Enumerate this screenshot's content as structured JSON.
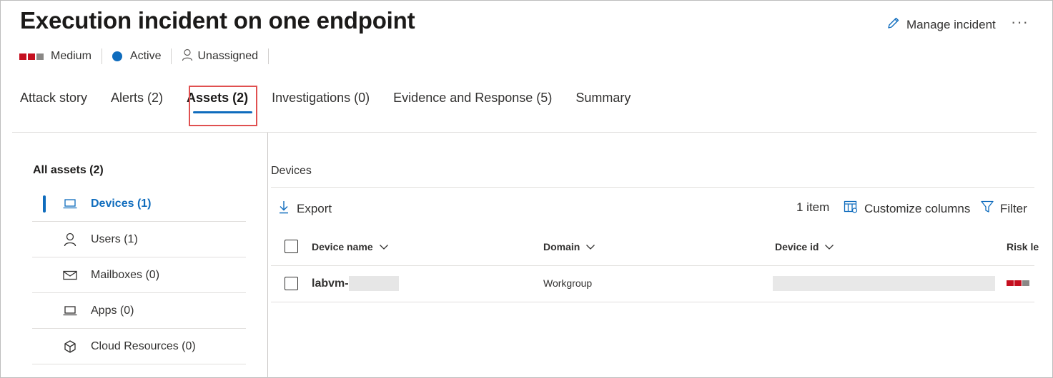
{
  "header": {
    "title": "Execution incident on one endpoint",
    "manage_label": "Manage incident",
    "more_label": "···"
  },
  "status": {
    "severity": "Medium",
    "severity_colors": [
      "#c50f1f",
      "#c50f1f",
      "#8a8886"
    ],
    "state": "Active",
    "state_color": "#0f6cbd",
    "assignee": "Unassigned"
  },
  "tabs": [
    {
      "label": "Attack story"
    },
    {
      "label": "Alerts (2)"
    },
    {
      "label": "Assets (2)",
      "active": true
    },
    {
      "label": "Investigations (0)"
    },
    {
      "label": "Evidence and Response (5)"
    },
    {
      "label": "Summary"
    }
  ],
  "sidebar": {
    "heading": "All assets (2)",
    "items": [
      {
        "label": "Devices (1)",
        "icon": "laptop-icon",
        "selected": true
      },
      {
        "label": "Users (1)",
        "icon": "user-icon"
      },
      {
        "label": "Mailboxes (0)",
        "icon": "mail-icon"
      },
      {
        "label": "Apps (0)",
        "icon": "laptop-icon"
      },
      {
        "label": "Cloud Resources (0)",
        "icon": "cube-icon"
      }
    ]
  },
  "devices": {
    "section_label": "Devices",
    "export_label": "Export",
    "count_label": "1 item",
    "customize_label": "Customize columns",
    "filter_label": "Filter",
    "columns": [
      "Device name",
      "Domain",
      "Device id",
      "Risk le"
    ],
    "rows": [
      {
        "device_name": "labvm-",
        "domain": "Workgroup",
        "risk_colors": [
          "#c50f1f",
          "#c50f1f",
          "#8a8886"
        ]
      }
    ]
  }
}
